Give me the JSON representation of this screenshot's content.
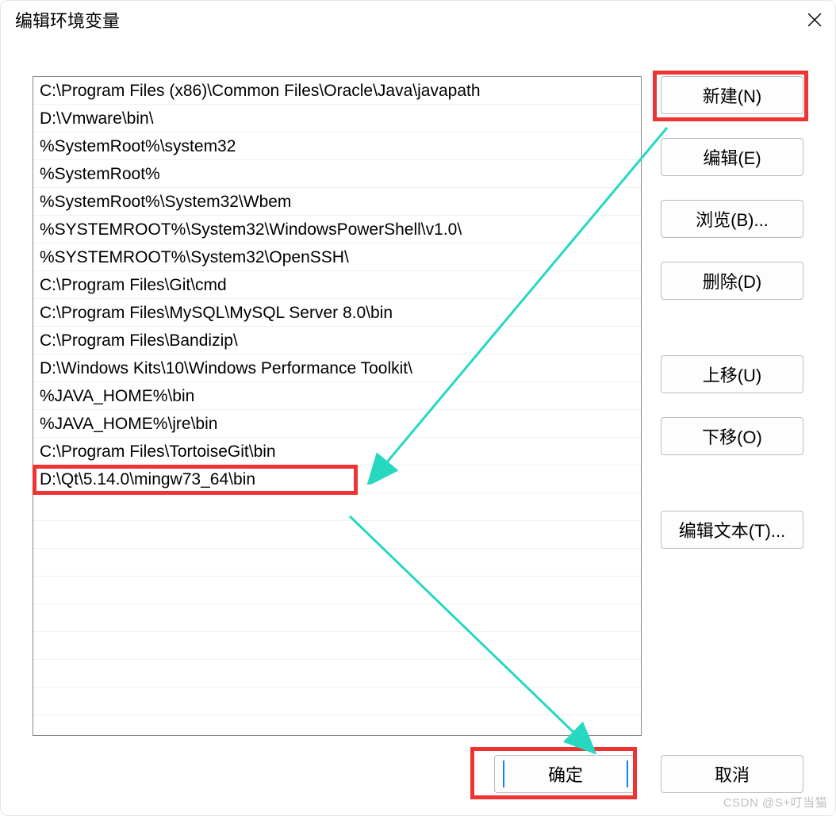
{
  "window": {
    "title": "编辑环境变量"
  },
  "entries": [
    "C:\\Program Files (x86)\\Common Files\\Oracle\\Java\\javapath",
    "D:\\Vmware\\bin\\",
    "%SystemRoot%\\system32",
    "%SystemRoot%",
    "%SystemRoot%\\System32\\Wbem",
    "%SYSTEMROOT%\\System32\\WindowsPowerShell\\v1.0\\",
    "%SYSTEMROOT%\\System32\\OpenSSH\\",
    "C:\\Program Files\\Git\\cmd",
    "C:\\Program Files\\MySQL\\MySQL Server 8.0\\bin",
    "C:\\Program Files\\Bandizip\\",
    "D:\\Windows Kits\\10\\Windows Performance Toolkit\\",
    "%JAVA_HOME%\\bin",
    "%JAVA_HOME%\\jre\\bin",
    "C:\\Program Files\\TortoiseGit\\bin",
    "D:\\Qt\\5.14.0\\mingw73_64\\bin"
  ],
  "highlighted_entry_index": 14,
  "buttons": {
    "new": "新建(N)",
    "edit": "编辑(E)",
    "browse": "浏览(B)...",
    "delete": "删除(D)",
    "moveup": "上移(U)",
    "movedown": "下移(O)",
    "edittext": "编辑文本(T)...",
    "ok": "确定",
    "cancel": "取消"
  },
  "annotations": {
    "highlight_color": "#e33333",
    "arrow_color": "#26d8c0",
    "watermark": "CSDN @S+叮当猫"
  }
}
